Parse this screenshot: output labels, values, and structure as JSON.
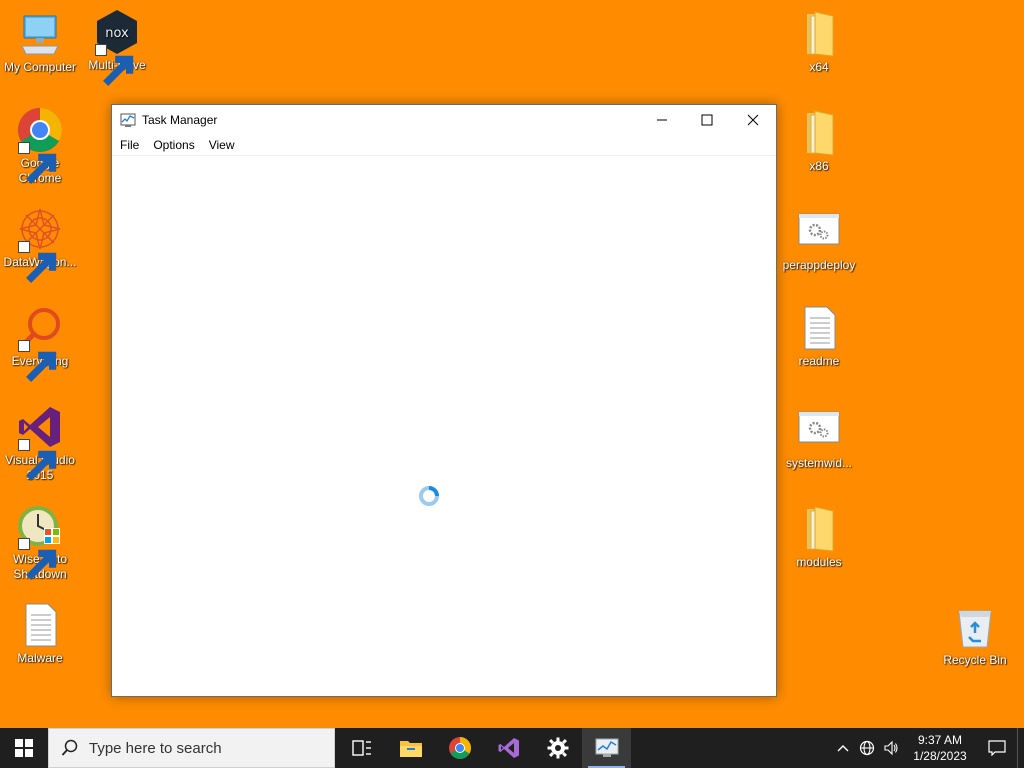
{
  "desktop": {
    "background_color": "#ff8c00",
    "left_icons": [
      {
        "label": "My Computer",
        "icon": "computer-icon"
      },
      {
        "label": "Multi-Drive",
        "icon": "nox-icon"
      },
      {
        "label": "Google Chrome",
        "icon": "chrome-icon"
      },
      {
        "label": "DataWagon...",
        "icon": "datawagon-icon"
      },
      {
        "label": "Everything",
        "icon": "everything-icon"
      },
      {
        "label": "Visual Studio 2015",
        "icon": "visual-studio-icon"
      },
      {
        "label": "Wise Auto Shutdown",
        "icon": "wise-shutdown-icon"
      },
      {
        "label": "Malware",
        "icon": "text-file-icon"
      }
    ],
    "right_icons": [
      {
        "label": "x64",
        "icon": "folder-icon"
      },
      {
        "label": "x86",
        "icon": "folder-icon"
      },
      {
        "label": "perappdeploy",
        "icon": "settings-file-icon"
      },
      {
        "label": "readme",
        "icon": "text-file-icon"
      },
      {
        "label": "systemwid...",
        "icon": "settings-file-icon"
      },
      {
        "label": "modules",
        "icon": "folder-icon"
      },
      {
        "label": "Recycle Bin",
        "icon": "recycle-bin-icon"
      }
    ]
  },
  "task_manager": {
    "title": "Task Manager",
    "menu": [
      "File",
      "Options",
      "View"
    ],
    "state": "loading"
  },
  "taskbar": {
    "search_placeholder": "Type here to search",
    "pinned": [
      {
        "name": "task-view",
        "icon": "task-view-icon"
      },
      {
        "name": "file-explorer",
        "icon": "folder-icon"
      },
      {
        "name": "chrome",
        "icon": "chrome-icon"
      },
      {
        "name": "visual-studio",
        "icon": "visual-studio-icon"
      },
      {
        "name": "settings",
        "icon": "gear-icon"
      },
      {
        "name": "task-manager",
        "icon": "task-manager-icon",
        "active": true
      }
    ],
    "clock": {
      "time": "9:37 AM",
      "date": "1/28/2023"
    },
    "accent": "#8ab4f8"
  }
}
